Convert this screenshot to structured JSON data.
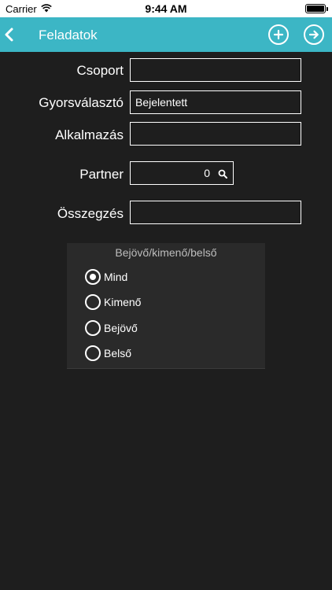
{
  "status_bar": {
    "carrier": "Carrier",
    "time": "9:44 AM",
    "wifi_icon": "wifi-icon",
    "battery_icon": "battery-icon"
  },
  "navbar": {
    "title": "Feladatok",
    "back_icon": "chevron-left-icon",
    "add_icon": "plus-circle-icon",
    "next_icon": "arrow-right-circle-icon",
    "background": "#3cb6c5"
  },
  "form": {
    "csoport": {
      "label": "Csoport",
      "value": ""
    },
    "gyorsvalaszto": {
      "label": "Gyorsválasztó",
      "value": "Bejelentett"
    },
    "alkalmazas": {
      "label": "Alkalmazás",
      "value": ""
    },
    "partner": {
      "label": "Partner",
      "value": "0",
      "search_icon": "search-icon"
    },
    "osszegzes": {
      "label": "Összegzés",
      "value": ""
    }
  },
  "direction": {
    "title": "Bejövő/kimenő/belső",
    "selected": "Mind",
    "options": [
      {
        "label": "Mind",
        "selected": true
      },
      {
        "label": "Kimenő",
        "selected": false
      },
      {
        "label": "Bejövő",
        "selected": false
      },
      {
        "label": "Belső",
        "selected": false
      }
    ]
  }
}
